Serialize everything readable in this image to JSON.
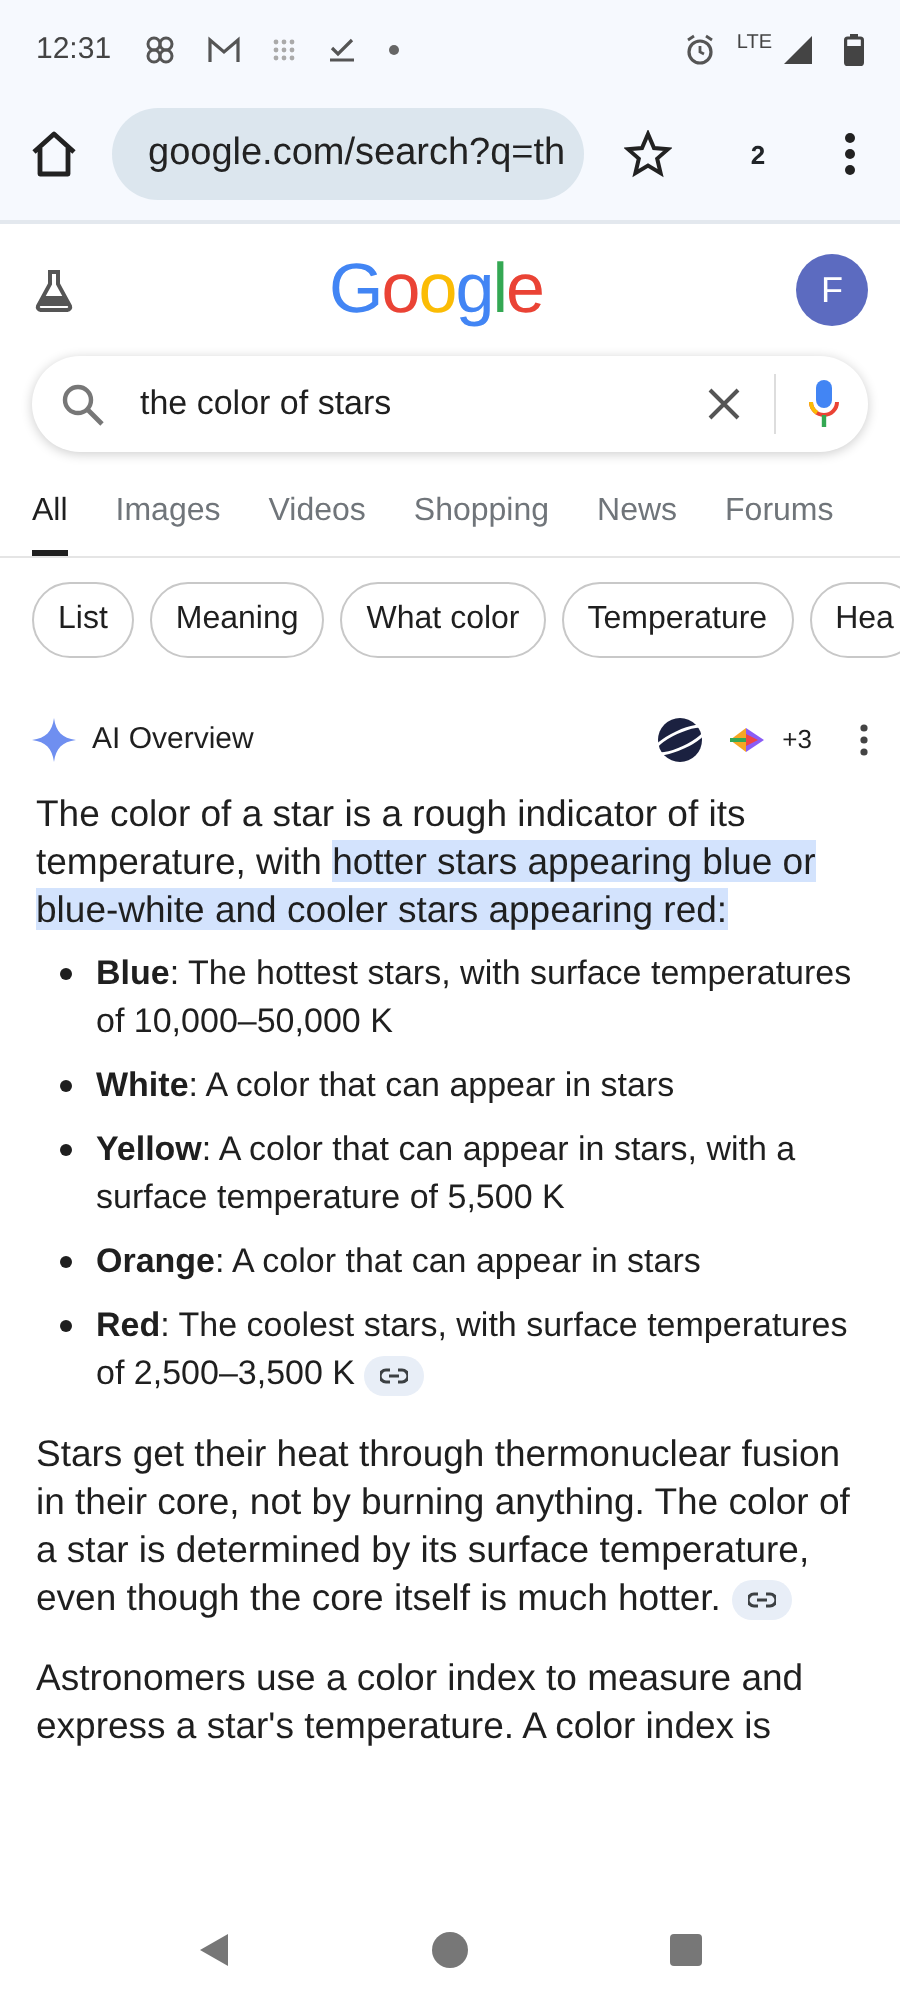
{
  "status_bar": {
    "time": "12:31",
    "network": "LTE"
  },
  "address_bar": {
    "url": "google.com/search?q=th",
    "tab_count": "2"
  },
  "header": {
    "logo": "Google",
    "avatar": "F"
  },
  "search": {
    "value": "the color of stars"
  },
  "tabs": [
    {
      "label": "All",
      "selected": true
    },
    {
      "label": "Images",
      "selected": false
    },
    {
      "label": "Videos",
      "selected": false
    },
    {
      "label": "Shopping",
      "selected": false
    },
    {
      "label": "News",
      "selected": false
    },
    {
      "label": "Forums",
      "selected": false
    }
  ],
  "chips": [
    "List",
    "Meaning",
    "What color",
    "Temperature",
    "Hea"
  ],
  "ai_overview": {
    "title": "AI Overview",
    "sources_more": "+3",
    "intro": [
      {
        "text": "The color of a star is a rough indicator of its temperature, with ",
        "highlighted": false
      },
      {
        "text": "hotter stars appearing blue or blue-white and cooler stars appearing red:",
        "highlighted": true
      }
    ],
    "bullets": [
      {
        "text": "**Blue**: The hottest stars, with surface temperatures of 10,000–50,000 K",
        "link": false
      },
      {
        "text": "**White**: A color that can appear in stars",
        "link": false
      },
      {
        "text": "**Yellow**: A color that can appear in stars, with a surface temperature of 5,500 K",
        "link": false
      },
      {
        "text": "**Orange**: A color that can appear in stars",
        "link": false
      },
      {
        "text": "**Red**: The coolest stars, with surface temperatures of 2,500–3,500 K",
        "link": true
      }
    ],
    "paragraphs": [
      {
        "text": "Stars get their heat through thermonuclear fusion in their core, not by burning anything. The color of a star is determined by its surface temperature, even though the core itself is much hotter.",
        "link": true
      },
      {
        "text": "Astronomers use a color index to measure and express a star's temperature. A color index is",
        "link": false
      }
    ]
  }
}
